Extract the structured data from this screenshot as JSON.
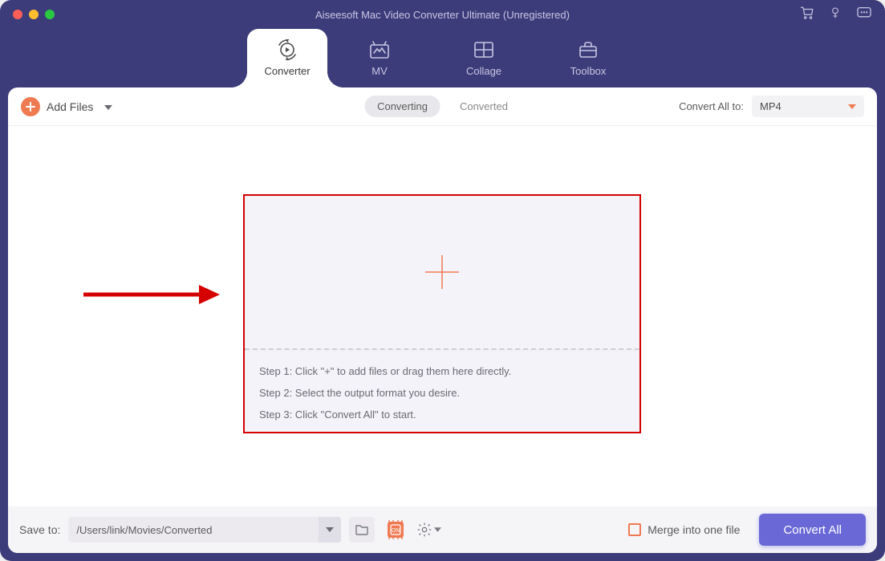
{
  "titlebar": {
    "title": "Aiseesoft Mac Video Converter Ultimate (Unregistered)"
  },
  "tabs": {
    "converter": "Converter",
    "mv": "MV",
    "collage": "Collage",
    "toolbox": "Toolbox"
  },
  "subtoolbar": {
    "add_files": "Add Files",
    "converting": "Converting",
    "converted": "Converted",
    "convert_all_to_label": "Convert All to:",
    "format": "MP4"
  },
  "dropzone": {
    "step1": "Step 1: Click \"+\" to add files or drag them here directly.",
    "step2": "Step 2: Select the output format you desire.",
    "step3": "Step 3: Click \"Convert All\" to start."
  },
  "bottombar": {
    "save_to_label": "Save to:",
    "save_path": "/Users/link/Movies/Converted",
    "merge_label": "Merge into one file",
    "convert_all": "Convert All"
  },
  "colors": {
    "header_bg": "#3d3c7a",
    "accent_orange": "#ef7a52",
    "primary_button": "#6a68d6",
    "annotation_red": "#d50000"
  }
}
